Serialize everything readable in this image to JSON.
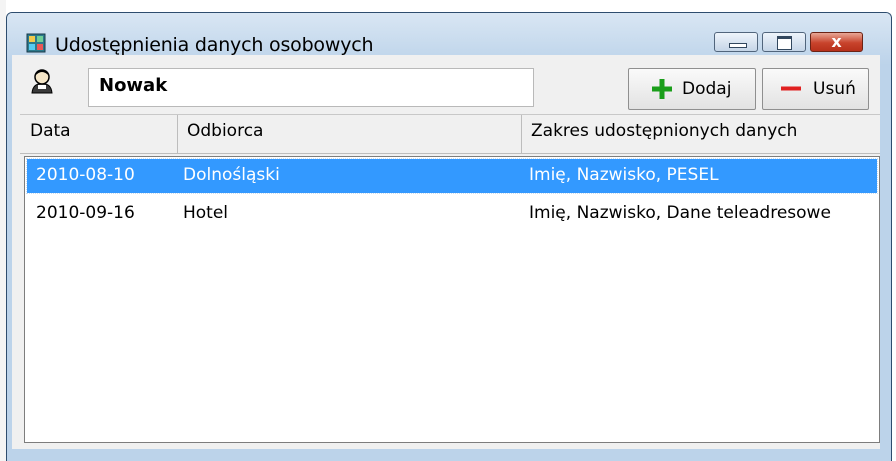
{
  "window": {
    "title": "Udostępnienia danych osobowych",
    "close_glyph": "x",
    "accent": "#3399ff"
  },
  "toolbar": {
    "person_icon": "person-icon",
    "name_value": "Nowak",
    "add_label": "Dodaj",
    "remove_label": "Usuń"
  },
  "table": {
    "columns": [
      "Data",
      "Odbiorca",
      "Zakres udostępnionych danych"
    ],
    "rows": [
      {
        "data": "2010-08-10",
        "odbiorca": "Dolnośląski",
        "zakres": "Imię, Nazwisko, PESEL",
        "selected": true
      },
      {
        "data": "2010-09-16",
        "odbiorca": "Hotel",
        "zakres": "Imię, Nazwisko, Dane teleadresowe",
        "selected": false
      }
    ]
  }
}
